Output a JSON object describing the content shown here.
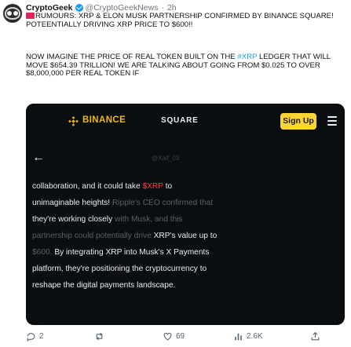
{
  "tweet": {
    "author_name": "CryptoGeek",
    "author_handle": "@CryptoGeekNews",
    "time": "2h",
    "line1": "RUMOURS: XRP & ELON MUSK PARTNERSHIP CONFIRMED BY BINANCE SQUARE! POTEENTIALLY DRIVING XRP PRICE TO $600!!",
    "line2_pre": "NOW IMAGINE THE PRICE OF REAL TOKEN BUILT ON THE ",
    "line2_tag": "#XRP",
    "line2_post": " LEDGER THAT WILL MOVE $654.39 TRILLION! WE ARE TALKING ABOUT GOING FROM $0.025 TO OVER $8,000,000 PER REAL TOKEN IF"
  },
  "embed": {
    "brand": "BINANCE",
    "section": "SQUARE",
    "signup_label": "Sign Up",
    "watermark": "@Xaif_03",
    "article": {
      "l1a": "collaboration, and it could take ",
      "l1b": "$XRP",
      "l1c": " to",
      "l2a": "unimaginable heights! ",
      "l2b": "Ripple's CEO confirmed that",
      "l3a": "they're working closely ",
      "l3b": "with Musk, and this",
      "l4a": "partnership could potentially drive ",
      "l4b": "XRP's value up to",
      "l5a": "$600. ",
      "l5b": "By integrating XRP into Musk's X Payments",
      "l6": "platform, they're positioning the cryptocurrency to",
      "l7": "reshape the digital payments landscape."
    }
  },
  "actions": {
    "replies": "2",
    "retweets": "",
    "likes": "69",
    "views": "2.6K"
  },
  "colors": {
    "accent": "#1d9bf0",
    "binance_yellow": "#f0b90b",
    "highlight_red": "#ff3b3b"
  }
}
